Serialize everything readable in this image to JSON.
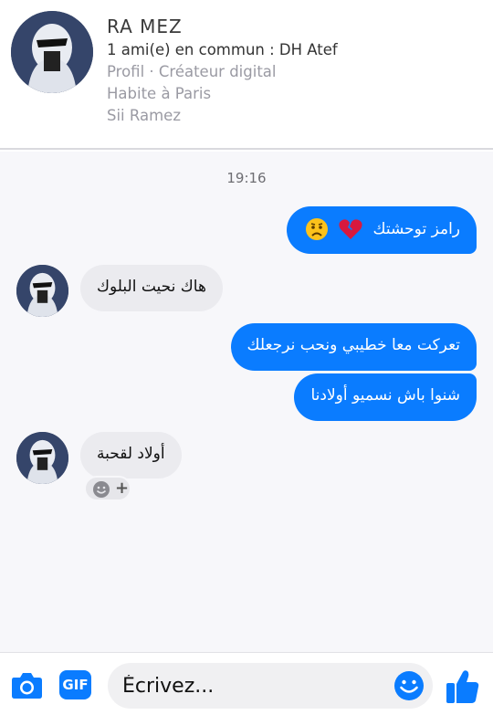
{
  "contact": {
    "name": "RA MEZ",
    "mutual": "1 ami(e) en commun : DH Atef",
    "profile_type": "Profil · Créateur digital",
    "location": "Habite à Paris",
    "school": "Sii Ramez"
  },
  "chat": {
    "timestamp": "19:16",
    "messages": [
      {
        "direction": "out",
        "text": "رامز توحشتك",
        "emoji": "broken-heart + sad-face"
      },
      {
        "direction": "in",
        "text": "هاك نحيت البلوك"
      },
      {
        "direction": "out",
        "text": "تعركت معا خطيبي ونحب نرجعلك"
      },
      {
        "direction": "out",
        "text": "شنوا باش نسميو أولادنا"
      },
      {
        "direction": "in",
        "text": "أولاد لقحبة"
      }
    ],
    "reaction_add": "+"
  },
  "composer": {
    "gif_label": "GIF",
    "placeholder": "Écrivez..."
  },
  "colors": {
    "accent": "#0a7cff",
    "incoming_bubble": "#ebebef",
    "chat_bg": "#f7f7fa"
  },
  "icons": [
    "camera-icon",
    "gif-icon",
    "emoji-icon",
    "thumbs-up-icon",
    "smiley-reaction-icon",
    "broken-heart-icon",
    "sad-face-icon"
  ]
}
